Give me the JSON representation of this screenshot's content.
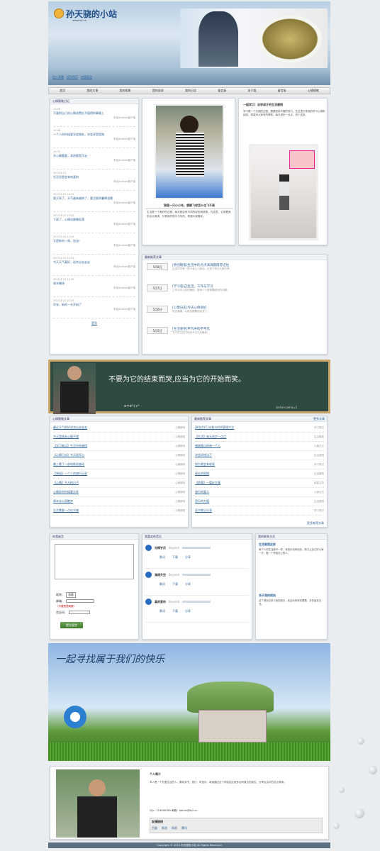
{
  "site": {
    "title": "孙天骁的小站",
    "subtitle": "www.ts2.cn",
    "links": [
      "加入收藏",
      "设为首页",
      "给我留言"
    ]
  },
  "nav": [
    "首页",
    "我的文章",
    "我的相册",
    "我的说说",
    "我的日志",
    "留言板",
    "关于我",
    "留言板",
    "心情随笔"
  ],
  "col1": {
    "title": "心情随笔日记",
    "items": [
      {
        "t": "13:56",
        "text": "不要把自己的心情浪费在不值得的事情上",
        "meta": "来自Android客户端"
      },
      {
        "t": "14:08",
        "text": "一个人的时候要学会独处，学会享受孤独",
        "meta": "来自Android客户端"
      },
      {
        "t": "14:31",
        "text": "开心最重要，其他都是浮云",
        "meta": "来自Android客户端"
      },
      {
        "t": "2013-5-15",
        "text": "生活总是会有惊喜的",
        "meta": "来自Android客户端"
      },
      {
        "t": "2013-5-15 14:21",
        "text": "夏天到了，天气越来越热了，要注意防暑降温哦",
        "meta": "来自Android客户端"
      },
      {
        "t": "2013-5-15 13:42",
        "text": "下雨了，心情也跟着低落",
        "meta": "来自Android客户端"
      },
      {
        "t": "2013-5-15 13:15",
        "text": "又是新的一周，加油！",
        "meta": "来自Android客户端"
      },
      {
        "t": "2013-5-15 12:51",
        "text": "今天天气真好，适合出去走走",
        "meta": "来自Android客户端"
      },
      {
        "t": "2013-5-15 11:30",
        "text": "周末愉快",
        "meta": "来自Android客户端"
      },
      {
        "t": "2013-5-15 10:20",
        "text": "早安，新的一天开始了",
        "meta": "来自Android客户端"
      }
    ],
    "more": "更多"
  },
  "photo_caption": "我是一只小小鸟，想要飞却怎么也飞不高",
  "photo_text": "生活是一个美好的过程，每天都会有不同的经历和感受。在这里，记录着我的点点滴滴，分享我的快乐与忧伤，希望大家喜欢。",
  "teacher": {
    "title": "一起学习：自学成才的生活感悟",
    "text": "学习是一个长期的过程，需要坚持不懈的努力。在这里分享我的学习心得和经验，希望对大家有所帮助。每天进步一点点，积少成多。"
  },
  "articles": {
    "title": "最新推荐文章",
    "items": [
      {
        "date": "5月8日",
        "title": "[原创随笔]生活中的点点滴滴都值得记住",
        "desc": "生活中总有一些小事让人感动，记录下来与大家分享。"
      },
      {
        "date": "5月7日",
        "title": "[学习笔记]生活，工作与学习",
        "desc": "工作与学习如何兼顾，是每个人都需要面对的问题。"
      },
      {
        "date": "5月6日",
        "title": "[心情日志]今天心情很好",
        "desc": "阳光明媚，心情也跟着好起来了。"
      },
      {
        "date": "5月5日",
        "title": "[生活感悟]平凡中的不平凡",
        "desc": "平凡的生活中也有不平凡的瞬间。"
      }
    ]
  },
  "banner": {
    "quote": "不要为它的结束而哭,应当为它的开始而笑。",
    "formula": "α=b²+c²",
    "formula2": "sin²α+cos²α=1"
  },
  "list_left": {
    "title": "心情随笔文章",
    "items": [
      {
        "t": "最近天气很好适合出去走走",
        "c": "心情随笔"
      },
      {
        "t": "今天是周末心情不错",
        "c": "心情随笔"
      },
      {
        "t": "【学习笔记】生活中的感悟",
        "c": "心情随笔"
      },
      {
        "t": "【心情日志】今天很开心",
        "c": "心情随笔"
      },
      {
        "t": "晚上看了一部电影很感动",
        "c": "心情随笔"
      },
      {
        "t": "【原创】一个人的旅行记录",
        "c": "心情随笔"
      },
      {
        "t": "【心情】平凡的日子",
        "c": "心情随笔"
      },
      {
        "t": "心情好的时候要分享",
        "c": "心情随笔"
      },
      {
        "t": "周末去公园散步",
        "c": "心情随笔"
      },
      {
        "t": "生活需要一点仪式感",
        "c": "心情随笔"
      }
    ]
  },
  "list_right": {
    "title": "最新推荐文章",
    "extra": "更多文章",
    "items": [
      {
        "t": "[原创]学习计划与时间管理方法",
        "c": "学习笔记"
      },
      {
        "t": "【生活】每天进步一点点",
        "c": "生活随笔"
      },
      {
        "t": "感谢身边的每一个人",
        "c": "心情日志"
      },
      {
        "t": "学会珍惜当下",
        "c": "生活感悟"
      },
      {
        "t": "努力就会有收获",
        "c": "学习笔记"
      },
      {
        "t": "成长的烦恼",
        "c": "生活随笔"
      },
      {
        "t": "【转载】一篇好文章",
        "c": "转载文章"
      },
      {
        "t": "旅行的意义",
        "c": "心情日志"
      },
      {
        "t": "音乐的力量",
        "c": "生活感悟"
      },
      {
        "t": "读书笔记分享",
        "c": "学习笔记"
      }
    ],
    "more": "更多推荐文章"
  },
  "guestbook": {
    "title": "给我留言",
    "name_label": "昵称：",
    "name_value": "游客",
    "email_label": "邮箱：",
    "captcha_label": "验证码：",
    "hint": "（不要恶意刷屏）",
    "submit": "提交留言"
  },
  "music": {
    "title": "我喜欢的音乐",
    "tracks": [
      {
        "title": "光辉岁月",
        "artist": "Beyond"
      },
      {
        "title": "海阔天空",
        "artist": "Beyond"
      },
      {
        "title": "真的爱你",
        "artist": "Beyond"
      }
    ],
    "labels": [
      "歌词",
      "下载",
      "分享"
    ]
  },
  "about": {
    "title": "我的联系方式",
    "sec1": "生活就是这样",
    "text1": "每个人的生活都不一样，有快乐也有忧伤。努力让自己开心每一天，做一个积极向上的人。",
    "sec2": "关于我的网站",
    "text2": "这个网站记录了我的成长，欢迎大家常来看看，多多留言交流。"
  },
  "footer_banner": {
    "text": "一起寻找属于我们的快乐"
  },
  "profile": {
    "title": "个人简介",
    "text": "本人是一个热爱生活的人，喜欢读书、旅行、听音乐。希望通过这个网站结交更多志同道合的朋友，分享生活中的点点滴滴。",
    "contact": "QQ：123456789  邮箱：admin@ts2.cn",
    "links_title": "友情链接",
    "links": [
      "百度",
      "新浪",
      "网易",
      "腾讯"
    ]
  },
  "footer": "Copyright © 2013 孙天骁的小站 All Rights Reserved"
}
